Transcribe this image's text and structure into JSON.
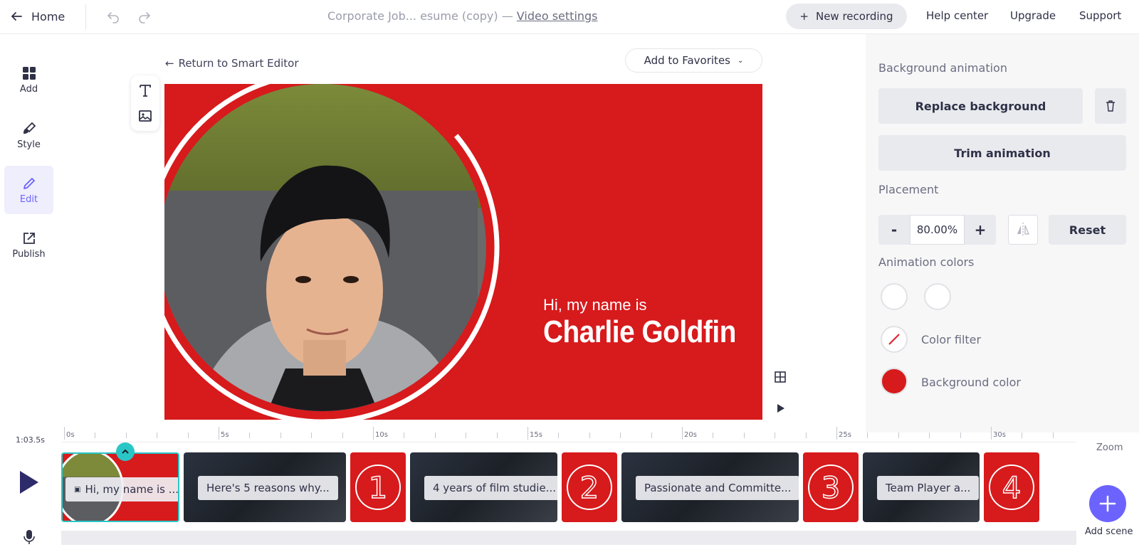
{
  "topbar": {
    "home_label": "Home",
    "doc_title": "Corporate Job... esume (copy)",
    "separator": "—",
    "video_settings": "Video settings",
    "new_recording": "New recording",
    "help_center": "Help center",
    "upgrade": "Upgrade",
    "support": "Support"
  },
  "leftnav": {
    "items": [
      {
        "label": "Add",
        "icon": "grid-icon"
      },
      {
        "label": "Style",
        "icon": "brush-icon"
      },
      {
        "label": "Edit",
        "icon": "pencil-icon",
        "active": true
      },
      {
        "label": "Publish",
        "icon": "share-icon"
      }
    ]
  },
  "editor": {
    "return_label": "Return to Smart Editor",
    "favorites_label": "Add to Favorites",
    "intro_text": "Hi, my name is",
    "name_text": "Charlie Goldfin"
  },
  "panel": {
    "bg_animation_heading": "Background animation",
    "replace_background": "Replace background",
    "trim_animation": "Trim animation",
    "placement_heading": "Placement",
    "minus": "-",
    "plus": "+",
    "placement_value": "80.00%",
    "reset": "Reset",
    "animation_colors_heading": "Animation colors",
    "color_filter": "Color filter",
    "background_color": "Background color",
    "bg_color_hex": "#d71a1c"
  },
  "timeline": {
    "duration": "1:03.5s",
    "ruler_labels": [
      "0s",
      "5s",
      "10s",
      "15s",
      "20s",
      "25s",
      "30s"
    ],
    "scenes": [
      {
        "type": "photo",
        "caption": "Hi, my name is ..."
      },
      {
        "type": "video",
        "caption": "Here's 5 reasons why..."
      },
      {
        "type": "number",
        "digit": "1"
      },
      {
        "type": "video",
        "caption": "4 years of film studie..."
      },
      {
        "type": "number",
        "digit": "2"
      },
      {
        "type": "video",
        "caption": "Passionate and Committe..."
      },
      {
        "type": "number",
        "digit": "3"
      },
      {
        "type": "video",
        "caption": "Team Player a..."
      },
      {
        "type": "number",
        "digit": "4"
      }
    ],
    "zoom_label": "Zoom",
    "add_scene_label": "Add scene"
  }
}
